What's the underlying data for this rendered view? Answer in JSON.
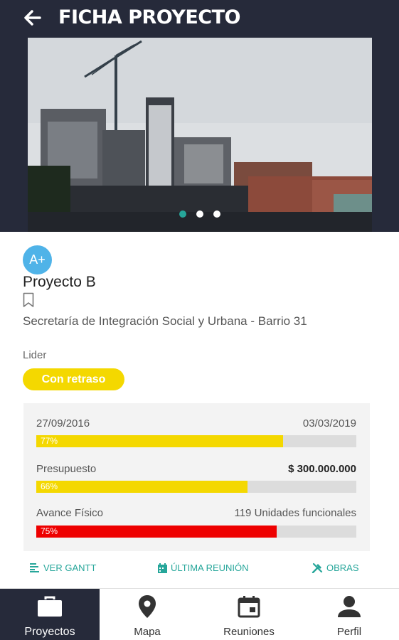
{
  "header": {
    "title": "FICHA PROYECTO"
  },
  "project": {
    "rating": "A+",
    "name": "Proyecto B",
    "organization": "Secretaría de Integración Social y Urbana - Barrio 31",
    "role": "Lider",
    "status": "Con retraso"
  },
  "carousel": {
    "slides": 3,
    "active_index": 0
  },
  "progress": {
    "start_date": "27/09/2016",
    "end_date": "03/03/2019",
    "time_pct_label": "77%",
    "time_pct": 0.77,
    "budget_label": "Presupuesto",
    "budget_value": "$ 300.000.000",
    "budget_pct_label": "66%",
    "budget_pct": 0.66,
    "physical_label": "Avance Físico",
    "physical_value": "119 Unidades funcionales",
    "physical_pct_label": "75%",
    "physical_pct": 0.75
  },
  "actions": {
    "gantt": "VER GANTT",
    "last_meeting": "ÚLTIMA REUNIÓN",
    "works": "OBRAS"
  },
  "bottom_nav": {
    "items": [
      {
        "label": "Proyectos",
        "icon": "briefcase-icon"
      },
      {
        "label": "Mapa",
        "icon": "map-pin-icon"
      },
      {
        "label": "Reuniones",
        "icon": "calendar-icon"
      },
      {
        "label": "Perfil",
        "icon": "person-icon"
      }
    ],
    "active": "Proyectos"
  },
  "colors": {
    "header_bg": "#262a3a",
    "accent": "#26a69a",
    "warning_yellow": "#f4d800",
    "danger_red": "#ee0000",
    "rating_blue": "#4fb3e8"
  }
}
